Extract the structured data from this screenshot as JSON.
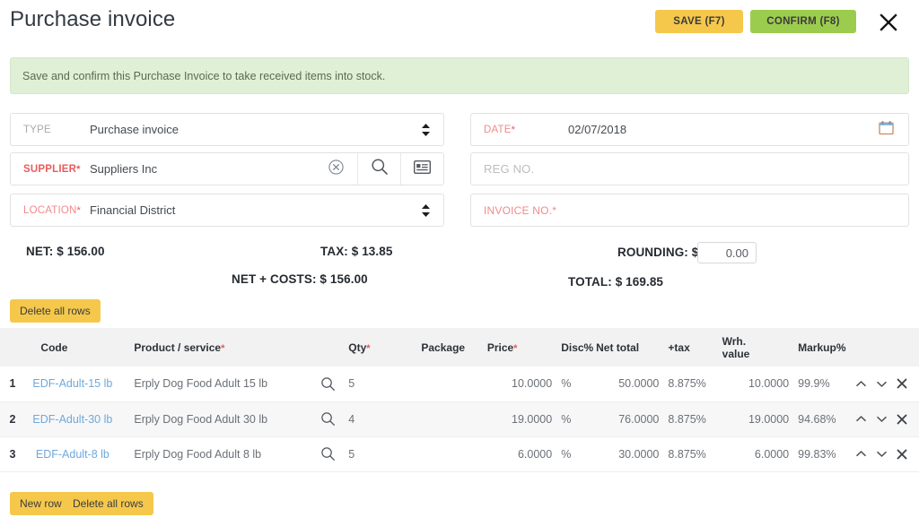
{
  "header": {
    "title": "Purchase invoice",
    "save_label": "SAVE (F7)",
    "confirm_label": "CONFIRM (F8)",
    "close_icon": "close-icon",
    "save_color": "#f5c84c",
    "confirm_color": "#9ccc4e"
  },
  "banner": {
    "text": "Save and confirm this Purchase Invoice to take received items into stock.",
    "background": "#dff0d6",
    "text_color": "#5a6b52"
  },
  "form": {
    "type": {
      "label": "TYPE",
      "value": "Purchase invoice",
      "required": false,
      "icon": "spinner-updown-icon"
    },
    "supplier": {
      "label": "SUPPLIER",
      "value": "Suppliers Inc",
      "required": true,
      "star": "*",
      "clear_icon": "clear-circle-icon",
      "search_icon": "search-icon",
      "card_icon": "contact-card-icon"
    },
    "location": {
      "label": "LOCATION",
      "value": "Financial District",
      "required": true,
      "star": "*",
      "icon": "spinner-updown-icon"
    },
    "date": {
      "label": "DATE",
      "star": "*",
      "value": "02/07/2018",
      "required": true,
      "icon": "calendar-icon"
    },
    "regno": {
      "label": "REG NO.",
      "value": "",
      "placeholder": "REG NO.",
      "required": false
    },
    "invoiceno": {
      "label": "INVOICE NO.",
      "star": "*",
      "value": "",
      "placeholder": "INVOICE NO.*",
      "required": true
    }
  },
  "totals": {
    "net": "NET: $ 156.00",
    "tax": "TAX: $ 13.85",
    "net_costs": "NET + COSTS: $ 156.00",
    "rounding_label": "ROUNDING: $",
    "rounding_value": "0.00",
    "total": "TOTAL: $ 169.85"
  },
  "buttons": {
    "delete_all_rows_top": "Delete all rows",
    "new_row": "New row",
    "delete_all_rows_bottom": "Delete all rows"
  },
  "table": {
    "headers": {
      "num": "",
      "code": "Code",
      "product": "Product / service",
      "product_star": "*",
      "qty": "Qty",
      "qty_star": "*",
      "package": "Package",
      "price": "Price",
      "price_star": "*",
      "disc": "Disc%",
      "net_total": "Net total",
      "tax": "+tax",
      "wrh_value_line1": "Wrh.",
      "wrh_value_line2": "value",
      "markup": "Markup%",
      "actions": ""
    },
    "rows": [
      {
        "num": "1",
        "code": "EDF-Adult-15 lb",
        "product": "Erply Dog Food Adult 15 lb",
        "search_icon": "search-icon",
        "qty": "5",
        "package": "",
        "price": "10.0000",
        "disc": "%",
        "net_total": "50.0000",
        "tax": "8.875%",
        "wrh_value": "10.0000",
        "markup": "99.9%",
        "actions": {
          "up": "chevron-up-icon",
          "down": "chevron-down-icon",
          "remove": "remove-row-icon"
        }
      },
      {
        "num": "2",
        "code": "EDF-Adult-30 lb",
        "product": "Erply Dog Food Adult 30 lb",
        "search_icon": "search-icon",
        "qty": "4",
        "package": "",
        "price": "19.0000",
        "disc": "%",
        "net_total": "76.0000",
        "tax": "8.875%",
        "wrh_value": "19.0000",
        "markup": "94.68%",
        "actions": {
          "up": "chevron-up-icon",
          "down": "chevron-down-icon",
          "remove": "remove-row-icon"
        }
      },
      {
        "num": "3",
        "code": "EDF-Adult-8 lb",
        "product": "Erply Dog Food Adult 8 lb",
        "search_icon": "search-icon",
        "qty": "5",
        "package": "",
        "price": "6.0000",
        "disc": "%",
        "net_total": "30.0000",
        "tax": "8.875%",
        "wrh_value": "6.0000",
        "markup": "99.83%",
        "actions": {
          "up": "chevron-up-icon",
          "down": "chevron-down-icon",
          "remove": "remove-row-icon"
        }
      }
    ]
  }
}
